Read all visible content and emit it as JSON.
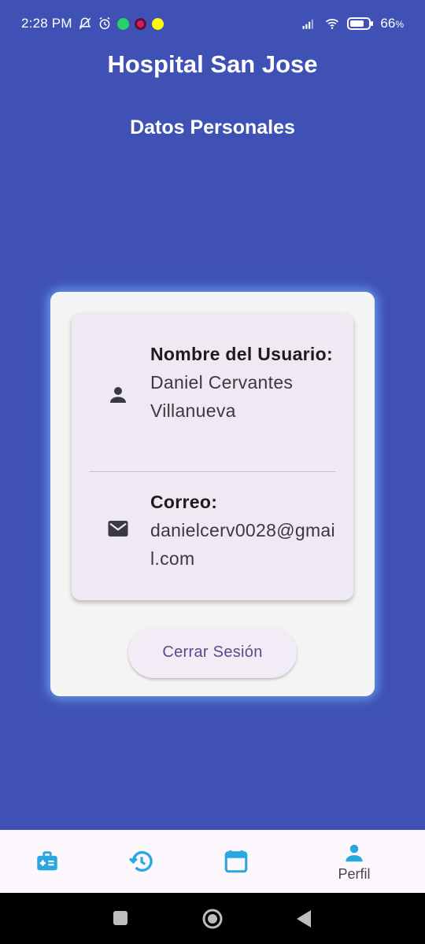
{
  "status_bar": {
    "time": "2:28 PM",
    "battery": "66",
    "battery_unit": "%",
    "left_icons": [
      "mute-icon",
      "alarm-icon",
      "whatsapp-icon",
      "target-app-icon",
      "snapchat-icon"
    ],
    "right_icons": [
      "signal-icon",
      "wifi-icon",
      "battery-icon"
    ]
  },
  "header": {
    "title": "Hospital San Jose",
    "subtitle": "Datos Personales"
  },
  "profile": {
    "name_label": "Nombre del Usuario:",
    "name_value": "Daniel Cervantes Villanueva",
    "email_label": "Correo:",
    "email_value": "danielcerv0028@gmail.com",
    "name_icon": "person-icon",
    "email_icon": "mail-icon"
  },
  "actions": {
    "logout_label": "Cerrar Sesión"
  },
  "bottom_nav": {
    "items": [
      {
        "icon": "medical-kit-icon",
        "label": ""
      },
      {
        "icon": "history-icon",
        "label": ""
      },
      {
        "icon": "calendar-icon",
        "label": ""
      },
      {
        "icon": "person-icon",
        "label": "Perfil",
        "active": true
      }
    ]
  },
  "colors": {
    "background": "#3f51b5",
    "nav_icon": "#29a8e0",
    "button_text": "#5b4a8a"
  }
}
